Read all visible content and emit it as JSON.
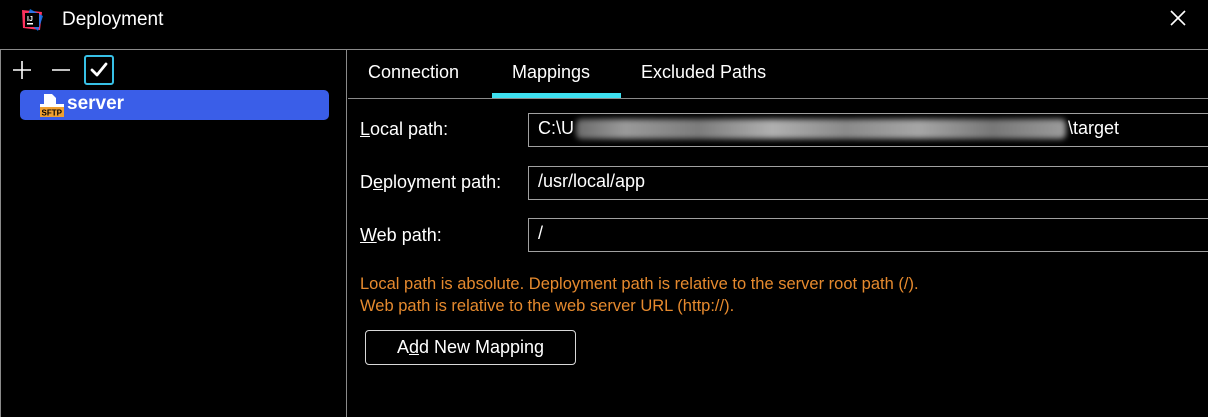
{
  "window": {
    "title": "Deployment",
    "app_icon": "intellij-idea-icon",
    "close_icon": "close-icon"
  },
  "toolbar": {
    "add_icon": "plus-icon",
    "remove_icon": "minus-icon",
    "default_icon": "checkmark-icon"
  },
  "servers": [
    {
      "label": "server",
      "icon": "sftp-icon",
      "icon_text": "SFTP",
      "selected": true
    }
  ],
  "tabs": [
    {
      "label": "Connection",
      "active": false
    },
    {
      "label": "Mappings",
      "active": true
    },
    {
      "label": "Excluded Paths",
      "active": false
    }
  ],
  "mappings": {
    "local_path": {
      "label_mnemonic": "L",
      "label_rest": "ocal path:",
      "value_start": "C:\\U",
      "value_end": "\\target"
    },
    "deployment_path": {
      "label_pre": "D",
      "label_mnemonic": "e",
      "label_rest": "ployment path:",
      "value": "/usr/local/app"
    },
    "web_path": {
      "label_mnemonic": "W",
      "label_rest": "eb path:",
      "value": "/"
    }
  },
  "hints": {
    "line1": "Local path is absolute. Deployment path is relative to the server root path (/).",
    "line2": "Web path is relative to the web server URL (http://)."
  },
  "add_button": {
    "pre": "A",
    "mnemonic": "d",
    "rest": "d New Mapping"
  },
  "colors": {
    "selection": "#3a5ee8",
    "tab_indicator": "#3ee0f0",
    "hint_text": "#e68a2e",
    "default_button_border": "#37c0e6"
  }
}
